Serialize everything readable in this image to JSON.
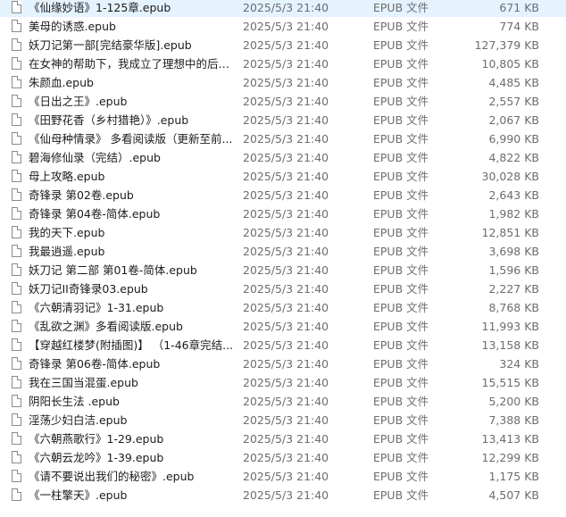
{
  "files": [
    {
      "name": "《仙缘妙语》1-125章.epub",
      "modified": "2025/5/3 21:40",
      "type": "EPUB 文件",
      "size": "671 KB"
    },
    {
      "name": "美母的诱惑.epub",
      "modified": "2025/5/3 21:40",
      "type": "EPUB 文件",
      "size": "774 KB"
    },
    {
      "name": "妖刀记第一部[完结豪华版].epub",
      "modified": "2025/5/3 21:40",
      "type": "EPUB 文件",
      "size": "127,379 KB"
    },
    {
      "name": "在女神的帮助下，我成立了理想中的后宫...",
      "modified": "2025/5/3 21:40",
      "type": "EPUB 文件",
      "size": "10,805 KB"
    },
    {
      "name": "朱颜血.epub",
      "modified": "2025/5/3 21:40",
      "type": "EPUB 文件",
      "size": "4,485 KB"
    },
    {
      "name": "《日出之王》.epub",
      "modified": "2025/5/3 21:40",
      "type": "EPUB 文件",
      "size": "2,557 KB"
    },
    {
      "name": "《田野花香（乡村猎艳）》.epub",
      "modified": "2025/5/3 21:40",
      "type": "EPUB 文件",
      "size": "2,067 KB"
    },
    {
      "name": "《仙母种情录》 多看阅读版（更新至前...",
      "modified": "2025/5/3 21:40",
      "type": "EPUB 文件",
      "size": "6,990 KB"
    },
    {
      "name": "碧海修仙录（完结）.epub",
      "modified": "2025/5/3 21:40",
      "type": "EPUB 文件",
      "size": "4,822 KB"
    },
    {
      "name": "母上攻略.epub",
      "modified": "2025/5/3 21:40",
      "type": "EPUB 文件",
      "size": "30,028 KB"
    },
    {
      "name": "奇锋录 第02卷.epub",
      "modified": "2025/5/3 21:40",
      "type": "EPUB 文件",
      "size": "2,643 KB"
    },
    {
      "name": "奇锋录 第04卷-简体.epub",
      "modified": "2025/5/3 21:40",
      "type": "EPUB 文件",
      "size": "1,982 KB"
    },
    {
      "name": "我的天下.epub",
      "modified": "2025/5/3 21:40",
      "type": "EPUB 文件",
      "size": "12,851 KB"
    },
    {
      "name": "我最逍遥.epub",
      "modified": "2025/5/3 21:40",
      "type": "EPUB 文件",
      "size": "3,698 KB"
    },
    {
      "name": "妖刀记 第二部 第01卷-简体.epub",
      "modified": "2025/5/3 21:40",
      "type": "EPUB 文件",
      "size": "1,596 KB"
    },
    {
      "name": "妖刀记II奇锋录03.epub",
      "modified": "2025/5/3 21:40",
      "type": "EPUB 文件",
      "size": "2,227 KB"
    },
    {
      "name": "《六朝清羽记》1-31.epub",
      "modified": "2025/5/3 21:40",
      "type": "EPUB 文件",
      "size": "8,768 KB"
    },
    {
      "name": "《乱欲之渊》多看阅读版.epub",
      "modified": "2025/5/3 21:40",
      "type": "EPUB 文件",
      "size": "11,993 KB"
    },
    {
      "name": "【穿越红楼梦(附插图)】 （1-46章完结...",
      "modified": "2025/5/3 21:40",
      "type": "EPUB 文件",
      "size": "13,158 KB"
    },
    {
      "name": "奇锋录 第06卷-简体.epub",
      "modified": "2025/5/3 21:40",
      "type": "EPUB 文件",
      "size": "324 KB"
    },
    {
      "name": "我在三国当混蛋.epub",
      "modified": "2025/5/3 21:40",
      "type": "EPUB 文件",
      "size": "15,515 KB"
    },
    {
      "name": "阴阳长生法 .epub",
      "modified": "2025/5/3 21:40",
      "type": "EPUB 文件",
      "size": "5,200 KB"
    },
    {
      "name": "淫荡少妇白洁.epub",
      "modified": "2025/5/3 21:40",
      "type": "EPUB 文件",
      "size": "7,388 KB"
    },
    {
      "name": "《六朝燕歌行》1-29.epub",
      "modified": "2025/5/3 21:40",
      "type": "EPUB 文件",
      "size": "13,413 KB"
    },
    {
      "name": "《六朝云龙吟》1-39.epub",
      "modified": "2025/5/3 21:40",
      "type": "EPUB 文件",
      "size": "12,299 KB"
    },
    {
      "name": "《请不要说出我们的秘密》.epub",
      "modified": "2025/5/3 21:40",
      "type": "EPUB 文件",
      "size": "1,175 KB"
    },
    {
      "name": "《一柱擎天》.epub",
      "modified": "2025/5/3 21:40",
      "type": "EPUB 文件",
      "size": "4,507 KB"
    }
  ],
  "icons": {
    "file": "file-icon"
  },
  "colors": {
    "hover": "#e5f3ff",
    "secondary_text": "#6d6d6d",
    "primary_text": "#1b1b1b"
  }
}
